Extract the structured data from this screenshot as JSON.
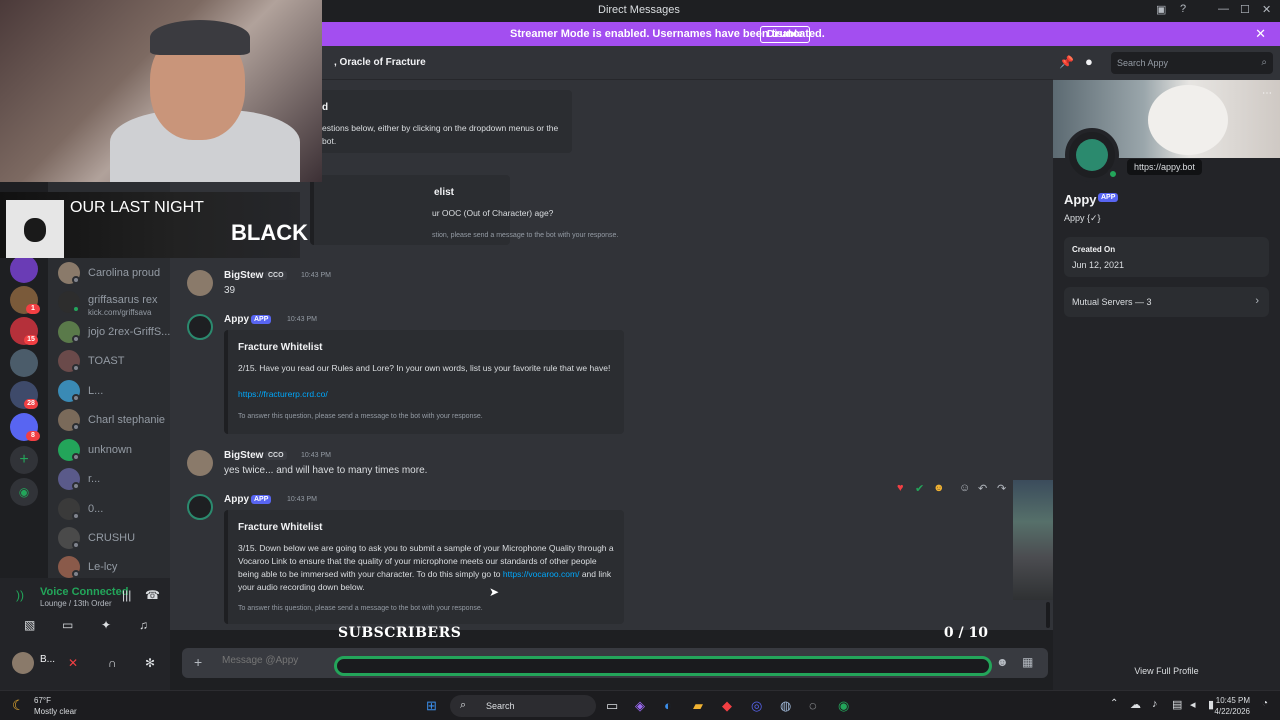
{
  "window": {
    "title": "Direct Messages"
  },
  "streamer_banner": {
    "message": "Streamer Mode is enabled. Usernames have been truncated.",
    "button": "Disable"
  },
  "chat_header": {
    "name": ", Oracle of Fracture"
  },
  "search": {
    "placeholder": "Search Appy"
  },
  "now_playing": {
    "line1": "OUR LAST NIGHT",
    "line2": "BLACK"
  },
  "dm_list": [
    {
      "name": "Carolina proud",
      "sub": ""
    },
    {
      "name": "griffasarus rex",
      "sub": "kick.com/griffsava"
    },
    {
      "name": "jojo 2rex-GriffS...",
      "sub": ""
    },
    {
      "name": "TOAST",
      "sub": ""
    },
    {
      "name": "L...",
      "sub": ""
    },
    {
      "name": "Charl stephanie",
      "sub": ""
    },
    {
      "name": "unknown",
      "sub": ""
    },
    {
      "name": "r...",
      "sub": ""
    },
    {
      "name": "0...",
      "sub": ""
    },
    {
      "name": "CRUSHU",
      "sub": ""
    },
    {
      "name": "Le-lcy",
      "sub": ""
    }
  ],
  "server_badges": [
    "1",
    "15",
    "28",
    "8"
  ],
  "voice": {
    "status": "Voice Connected",
    "channel": "Lounge / 13th Order",
    "user": "B..."
  },
  "messages": {
    "partial_embed_1": {
      "title_frag": "d",
      "body": "estions below, either by clicking on the dropdown menus or the bot."
    },
    "partial_embed_2": {
      "title_frag": "elist",
      "body": "ur OOC (Out of Character) age?",
      "footer": "stion, please send a message to the bot with your response."
    },
    "msg1": {
      "author": "BigStew",
      "tag": "CCO",
      "time": "10:43 PM",
      "text": "39"
    },
    "msg2": {
      "author": "Appy",
      "tag": "APP",
      "time": "10:43 PM",
      "embed_title": "Fracture Whitelist",
      "embed_body": "2/15. Have you read our Rules and Lore? In your own words, list us your favorite rule that we have!",
      "embed_link": "https://fracturerp.crd.co/",
      "embed_footer": "To answer this question, please send a message to the bot with your response."
    },
    "msg3": {
      "author": "BigStew",
      "tag": "CCO",
      "time": "10:43 PM",
      "text": "yes twice... and will have to many times more."
    },
    "msg4": {
      "author": "Appy",
      "tag": "APP",
      "time": "10:43 PM",
      "embed_title": "Fracture Whitelist",
      "embed_body_a": "3/15. Down below we are going to ask you to submit a sample of your Microphone Quality through a Vocaroo Link to ensure that the quality of your microphone meets our standards of other people being able to be immersed with your character. To do this simply go to ",
      "embed_link": "https://vocaroo.com/",
      "embed_body_b": " and link your audio recording down below.",
      "embed_footer": "To answer this question, please send a message to the bot with your response."
    }
  },
  "subscribers": {
    "label": "SUBSCRIBERS",
    "count": "0 / 10",
    "progress": 0
  },
  "message_input": {
    "placeholder": "Message @Appy"
  },
  "profile": {
    "tooltip": "https://appy.bot",
    "name": "Appy",
    "tag": "APP",
    "username": "Appy {✓}",
    "created_label": "Created On",
    "created_value": "Jun 12, 2021",
    "mutual": "Mutual Servers — 3",
    "view_full": "View Full Profile"
  },
  "taskbar": {
    "weather_temp": "67°F",
    "weather_desc": "Mostly clear",
    "search": "Search",
    "time": "10:45 PM",
    "date": "4/22/2026"
  },
  "colors": {
    "accent": "#5865f2",
    "banner": "#a34ef0",
    "online": "#23a55a",
    "link": "#00a8fc"
  }
}
